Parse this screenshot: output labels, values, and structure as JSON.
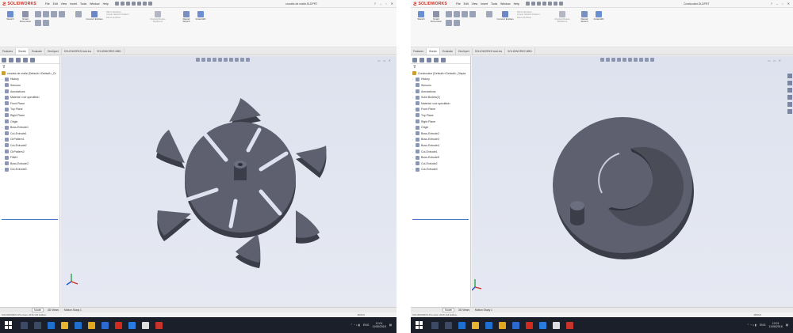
{
  "left": {
    "logo": "SOLIDWORKS",
    "menus": [
      "File",
      "Edit",
      "View",
      "Insert",
      "Tools",
      "Window",
      "Help"
    ],
    "doc_title": "cruceta de malla.SLDPRT",
    "ribbon": [
      "Sketch",
      "Smart Dimension",
      "Convert Entities",
      "Mirror Entities",
      "Linear Sketch Pattern",
      "Move Entities",
      "Display/Delete Relations",
      "Repair Sketch",
      "Instant2D"
    ],
    "tabs": [
      "Features",
      "Sketch",
      "Evaluate",
      "DimXpert",
      "SOLIDWORKS Add-Ins",
      "SOLIDWORKS MBD"
    ],
    "tree_root": "cruceta de malla (Default<<Default>_Di",
    "tree": [
      "History",
      "Sensors",
      "Annotations",
      "Material <not specified>",
      "Front Plane",
      "Top Plane",
      "Right Plane",
      "Origin",
      "Boss-Extrude1",
      "Cut-Extrude1",
      "CirPattern1",
      "Cut-Extrude2",
      "CirPattern2",
      "Fillet1",
      "Boss-Extrude2",
      "Cut-Extrude3"
    ],
    "bottom_tabs": [
      "Model",
      "3D Views",
      "Motion Study 1"
    ],
    "status": "SOLIDWORKS Premium 2016 x64 Edition",
    "units": "MMGS",
    "clock_time": "12:01",
    "clock_date": "11/06/2018",
    "lang": "ENG"
  },
  "right": {
    "logo": "SOLIDWORKS",
    "menus": [
      "File",
      "Edit",
      "View",
      "Insert",
      "Tools",
      "Window",
      "Help"
    ],
    "doc_title": "Conducator.SLDPRT",
    "ribbon": [
      "Sketch",
      "Smart Dimension",
      "Convert Entities",
      "Mirror Entities",
      "Linear Sketch Pattern",
      "Move Entities",
      "Display/Delete Relations",
      "Repair Sketch",
      "Instant2D"
    ],
    "tabs": [
      "Features",
      "Sketch",
      "Evaluate",
      "DimXpert",
      "SOLIDWORKS Add-Ins",
      "SOLIDWORKS MBD"
    ],
    "tree_root": "Conducator (Default<<Default>_Displa",
    "tree": [
      "History",
      "Sensors",
      "Annotations",
      "Solid Bodies(2)",
      "Material <not specified>",
      "Front Plane",
      "Top Plane",
      "Right Plane",
      "Origin",
      "Boss-Extrude2",
      "Boss-Extrude3",
      "Boss-Extrude4",
      "Cut-Extrude1",
      "Boss-Extrude5",
      "Cut-Extrude2",
      "Cut-Extrude3"
    ],
    "bottom_tabs": [
      "Model",
      "3D Views",
      "Motion Study 1"
    ],
    "status": "SOLIDWORKS Premium 2016 x64 Edition",
    "units": "MMGS",
    "clock_time": "12:01",
    "clock_date": "11/06/2018",
    "lang": "ENG"
  },
  "colors": {
    "part_face": "#5e6070",
    "part_side": "#3b3d48",
    "viewport_bg": "#e1e5ef",
    "taskbar": "#1b1f2a",
    "brand": "#d12a1f"
  },
  "icons": [
    "solidworks-logo-icon",
    "new-icon",
    "open-icon",
    "save-icon",
    "print-icon",
    "undo-icon",
    "rebuild-icon",
    "options-icon",
    "filter-icon",
    "triad-icon",
    "windows-start-icon"
  ]
}
